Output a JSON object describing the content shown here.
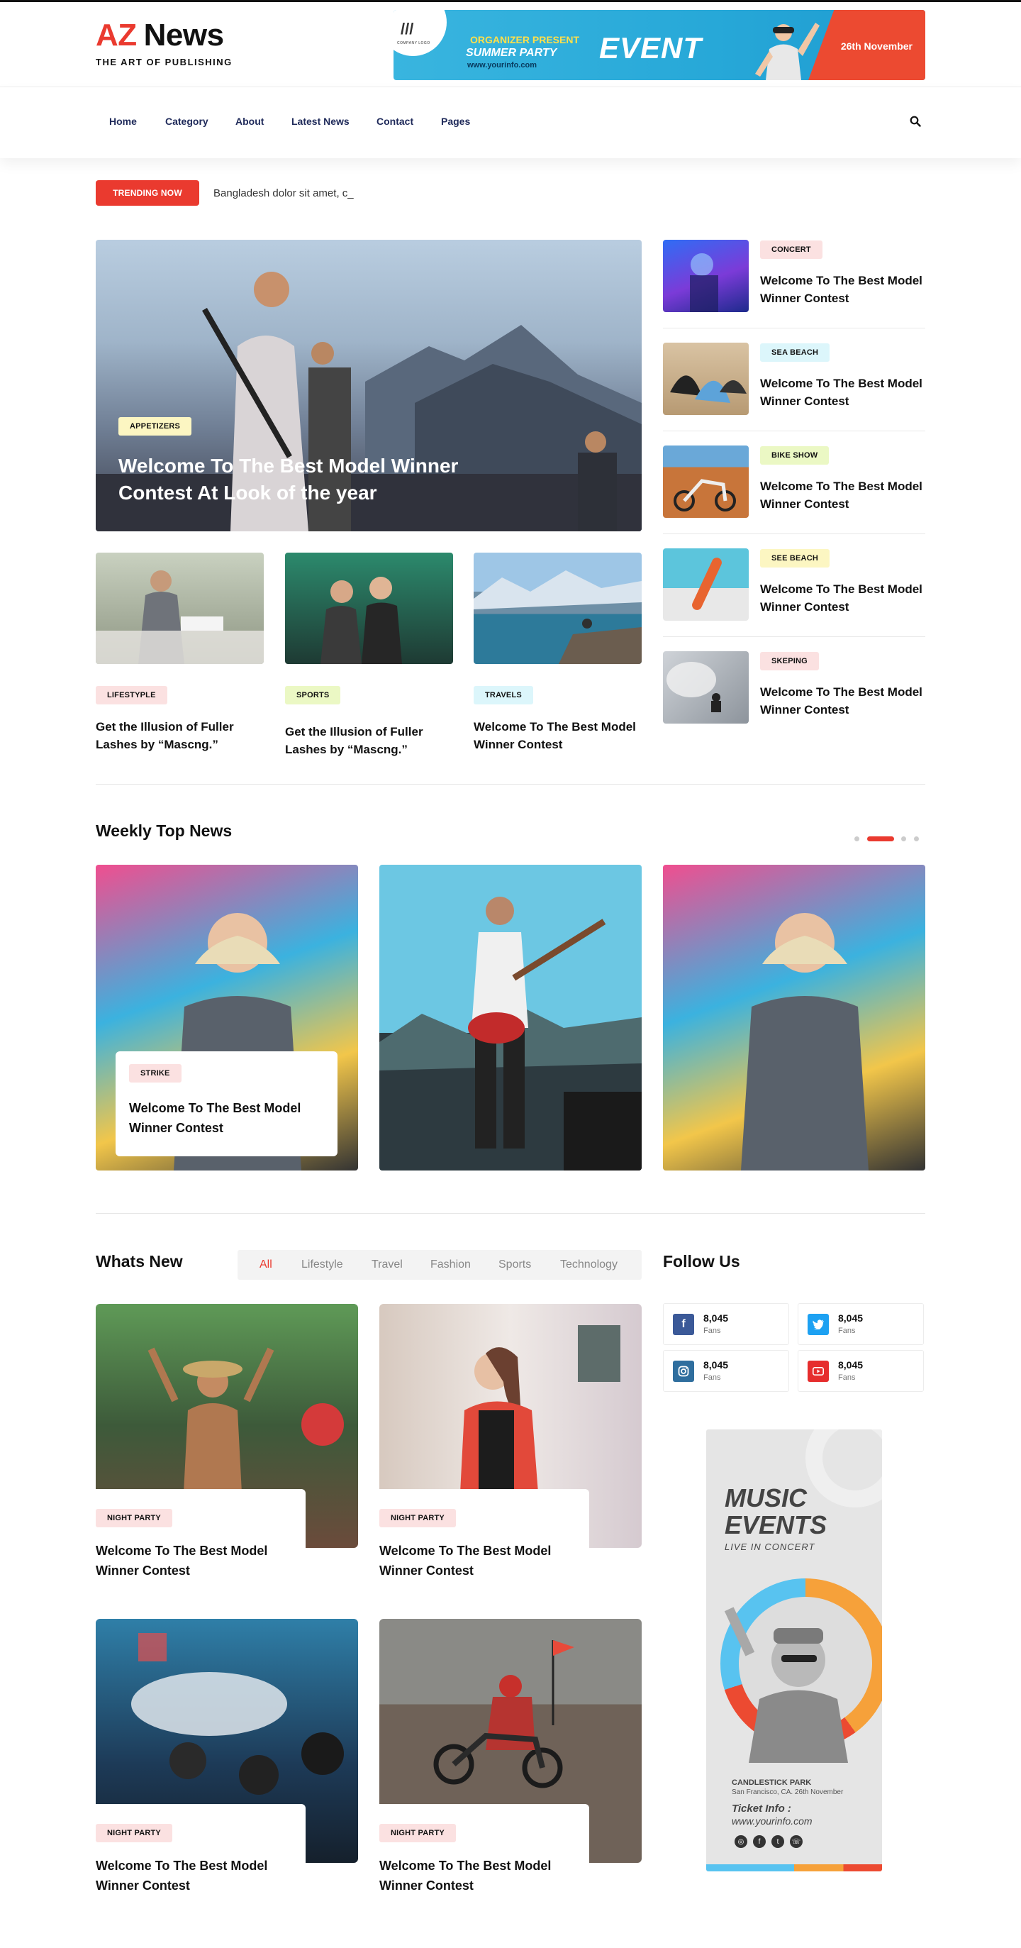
{
  "header": {
    "logo_az": "AZ",
    "logo_news": "News",
    "tagline": "THE ART OF PUBLISHING",
    "banner": {
      "company": "COMPANY LOGO",
      "organizer": "ORGANIZER PRESENT",
      "party": "SUMMER PARTY",
      "url": "www.yourinfo.com",
      "event": "EVENT",
      "date": "26th November"
    }
  },
  "nav": {
    "items": [
      "Home",
      "Category",
      "About",
      "Latest News",
      "Contact",
      "Pages"
    ],
    "search_icon": "search-icon"
  },
  "trending": {
    "label": "TRENDING NOW",
    "text": "Bangladesh dolor sit amet, c_"
  },
  "hero": {
    "tag": "APPETIZERS",
    "title": "Welcome To The Best Model Winner Contest At Look of the year"
  },
  "side_list": [
    {
      "tag": "CONCERT",
      "title": "Welcome To The Best Model Winner Contest"
    },
    {
      "tag": "SEA BEACH",
      "title": "Welcome To The Best Model Winner Contest"
    },
    {
      "tag": "BIKE SHOW",
      "title": "Welcome To The Best Model Winner Contest"
    },
    {
      "tag": "SEE BEACH",
      "title": "Welcome To The Best Model Winner Contest"
    },
    {
      "tag": "SKEPING",
      "title": "Welcome To The Best Model Winner Contest"
    }
  ],
  "small_cards": [
    {
      "tag": "LIFESTYPLE",
      "title": "Get the Illusion of Fuller Lashes by “Mascng.”"
    },
    {
      "tag": "SPORTS",
      "title": "Get the Illusion of Fuller Lashes by “Mascng.”"
    },
    {
      "tag": "TRAVELS",
      "title": "Welcome To The Best Model Winner Contest"
    }
  ],
  "weekly": {
    "title": "Weekly Top News",
    "card": {
      "tag": "STRIKE",
      "title": "Welcome To The Best Model Winner Contest"
    }
  },
  "whats_new": {
    "title": "Whats New",
    "filters": [
      "All",
      "Lifestyle",
      "Travel",
      "Fashion",
      "Sports",
      "Technology"
    ],
    "cards": [
      {
        "tag": "NIGHT PARTY",
        "title": "Welcome To The Best Model Winner Contest"
      },
      {
        "tag": "NIGHT PARTY",
        "title": "Welcome To The Best Model Winner Contest"
      },
      {
        "tag": "NIGHT PARTY",
        "title": "Welcome To The Best Model Winner Contest"
      },
      {
        "tag": "NIGHT PARTY",
        "title": "Welcome To The Best Model Winner Contest"
      }
    ]
  },
  "follow": {
    "title": "Follow Us",
    "items": [
      {
        "network": "facebook",
        "icon": "facebook-icon",
        "count": "8,045",
        "label": "Fans",
        "color": "#3b5998"
      },
      {
        "network": "twitter",
        "icon": "twitter-icon",
        "count": "8,045",
        "label": "Fans",
        "color": "#1da1f2"
      },
      {
        "network": "instagram",
        "icon": "instagram-icon",
        "count": "8,045",
        "label": "Fans",
        "color": "#2f6e9e"
      },
      {
        "network": "youtube",
        "icon": "youtube-icon",
        "count": "8,045",
        "label": "Fans",
        "color": "#e62d2d"
      }
    ]
  },
  "poster": {
    "music": "MUSIC",
    "events": "EVENTS",
    "live": "LIVE IN CONCERT",
    "venue": "CANDLESTICK PARK",
    "address": "San Francisco, CA. 26th November",
    "ticket": "Ticket Info :",
    "url": "www.yourinfo.com"
  },
  "colors": {
    "accent": "#ea3a2f",
    "nav_text": "#1f2a5a"
  }
}
